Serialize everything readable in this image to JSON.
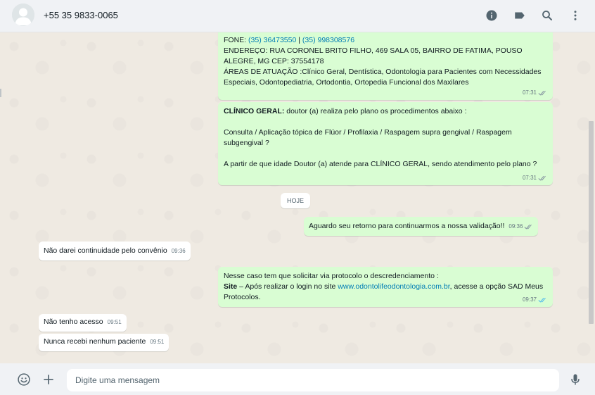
{
  "header": {
    "contact_name": "+55 35 9833-0065",
    "icons": [
      "info-icon",
      "label-icon",
      "search-icon",
      "menu-icon"
    ]
  },
  "messages": {
    "m1": {
      "fone_label": "FONE: ",
      "phone1": "(35) 36473550",
      "sep": " | ",
      "phone2": "(35) 998308576",
      "address": "ENDEREÇO: RUA CORONEL BRITO FILHO, 469 SALA 05, BAIRRO DE FATIMA, POUSO ALEGRE, MG CEP: 37554178",
      "areas": "ÁREAS DE ATUAÇÃO :Clínico Geral, Dentística, Odontologia para Pacientes com Necessidades Especiais, Odontopediatria, Ortodontia, Ortopedia Funcional dos Maxilares",
      "time": "07:31"
    },
    "m2": {
      "bold": "CLÍNICO GERAL:",
      "line1": "  doutor (a) realiza pelo plano os procedimentos abaixo :",
      "procedures": "Consulta /  Aplicação tópica de Flúor  /  Profilaxia / Raspagem supra gengival / Raspagem subgengival ?",
      "question": " A partir de que idade Doutor (a) atende para CLÍNICO GERAL, sendo atendimento pelo plano ?",
      "time": "07:31"
    },
    "date_chip": "HOJE",
    "m3": {
      "text": "Aguardo seu retorno para continuarmos a nossa validação!!",
      "time": "09:36"
    },
    "m4": {
      "text": "Não darei continuidade pelo convênio",
      "time": "09:36"
    },
    "m5": {
      "line1": "Nesse caso tem que solicitar via protocolo o descredenciamento :",
      "bold": "Site",
      "line2a": " – Após realizar o login no site ",
      "link": "www.odontolifeodontologia.com.br",
      "line2b": ", acesse a opção SAD Meus Protocolos.",
      "time": "09:37"
    },
    "m6": {
      "text": "Não tenho acesso",
      "time": "09:51"
    },
    "m7": {
      "text": "Nunca recebi nenhum paciente",
      "time": "09:51"
    }
  },
  "footer": {
    "placeholder": "Digite uma mensagem",
    "icons": [
      "emoji-icon",
      "plus-icon",
      "microphone-icon"
    ]
  },
  "colors": {
    "outgoing_bubble": "#d9fdd3",
    "incoming_bubble": "#ffffff",
    "link": "#027eb5",
    "read_ticks": "#53bdeb",
    "chat_background": "#efeae2"
  }
}
